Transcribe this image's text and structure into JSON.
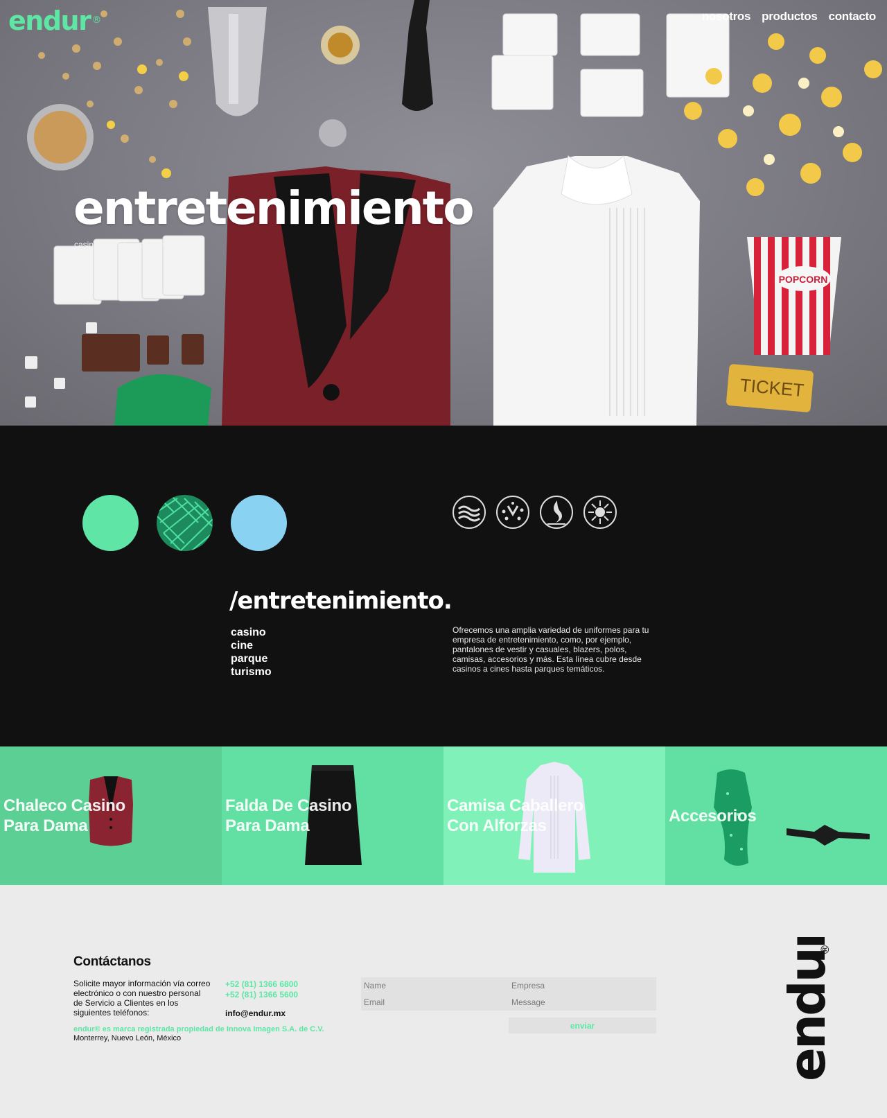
{
  "header": {
    "logo": "endur",
    "logo_mark": "®",
    "nav": [
      "nosotros",
      "productos",
      "contacto"
    ]
  },
  "hero": {
    "title": "entretenimiento",
    "subtitle": "casino / cine / parque / turismo",
    "ticket_text": "TICKET",
    "popcorn_text": "POPCORN"
  },
  "colors": {
    "accent": "#5ee6a4",
    "dark_bg": "#121112",
    "light_bg": "#ebebeb",
    "swatches": [
      "#5fe6a6",
      "#1d8a5e",
      "#8ad2f2"
    ],
    "card_bgs": [
      "#5ccf95",
      "#62e0a3",
      "#80f2b9",
      "#62e0a3"
    ]
  },
  "section": {
    "swatch_names": [
      "mint-swatch",
      "green-pattern-swatch",
      "light-blue-swatch"
    ],
    "features": [
      "water-resistant-icon",
      "stain-resistant-icon",
      "flame-resistant-icon",
      "antibacterial-icon"
    ],
    "title": "/entretenimiento.",
    "categories": [
      "casino",
      "cine",
      "parque",
      "turismo"
    ],
    "description": "Ofrecemos una amplia variedad de uniformes para tu empresa de entretenimiento, como, por ejemplo, pantalones de vestir y casuales, blazers, polos, camisas, accesorios y más. Esta línea cubre desde casinos a cines hasta parques temáticos."
  },
  "products": [
    {
      "label_line1": "Chaleco Casino",
      "label_line2": "Para Dama",
      "image": "vest-image"
    },
    {
      "label_line1": "Falda De Casino",
      "label_line2": "Para Dama",
      "image": "skirt-image"
    },
    {
      "label_line1": "Camisa Caballero",
      "label_line2": "Con Alforzas",
      "image": "shirt-image"
    },
    {
      "label_line1": "Accesorios",
      "label_line2": "",
      "image": "accessories-image"
    }
  ],
  "contact": {
    "title": "Contáctanos",
    "text": "Solicite mayor información vía correo electrónico o con nuestro personal de Servicio a Clientes en los siguientes teléfonos:",
    "phone1": "+52 (81) 1366 6800",
    "phone2": "+52 (81) 1366 5600",
    "email": "info@endur.mx",
    "brand_note": "endur® es marca registrada propiedad de Innova Imagen S.A. de C.V.",
    "address": "Monterrey, Nuevo León, México",
    "form": {
      "name_placeholder": "Name",
      "company_placeholder": "Empresa",
      "email_placeholder": "Email",
      "message_placeholder": "Message",
      "submit": "enviar"
    },
    "vertical_logo": "endur",
    "vertical_logo_mark": "®"
  }
}
